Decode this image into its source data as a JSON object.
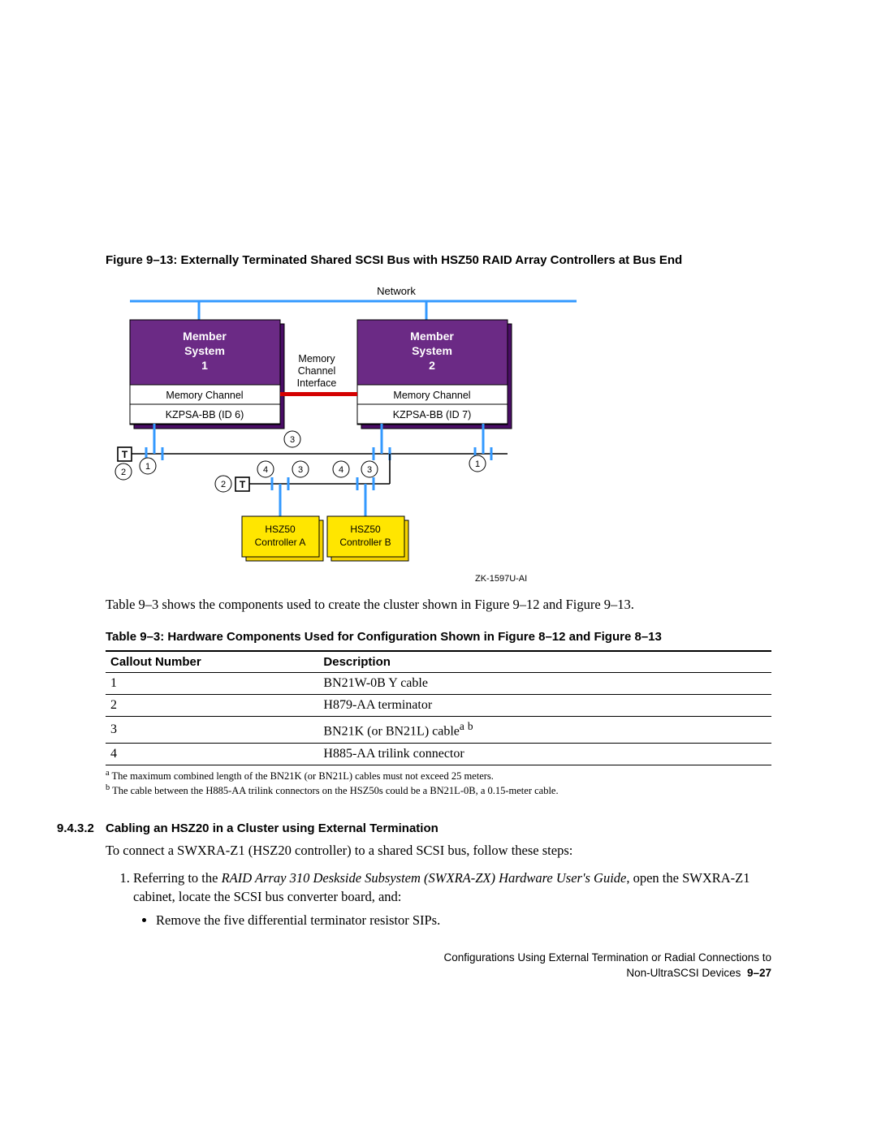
{
  "figure": {
    "caption": "Figure 9–13: Externally Terminated Shared SCSI Bus with HSZ50 RAID Array Controllers at Bus End",
    "labels": {
      "network": "Network",
      "member1_l1": "Member",
      "member1_l2": "System",
      "member1_l3": "1",
      "member2_l1": "Member",
      "member2_l2": "System",
      "member2_l3": "2",
      "mci_l1": "Memory",
      "mci_l2": "Channel",
      "mci_l3": "Interface",
      "mc1": "Memory Channel",
      "mc2": "Memory Channel",
      "kzpsa1": "KZPSA-BB (ID 6)",
      "kzpsa2": "KZPSA-BB (ID 7)",
      "hsz_a_l1": "HSZ50",
      "hsz_a_l2": "Controller A",
      "hsz_b_l1": "HSZ50",
      "hsz_b_l2": "Controller B",
      "T": "T",
      "c1": "1",
      "c2": "2",
      "c3": "3",
      "c4": "4"
    },
    "id": "ZK-1597U-AI"
  },
  "intro_text": "Table 9–3 shows the components used to create the cluster shown in Figure 9–12 and Figure 9–13.",
  "table": {
    "caption": "Table 9–3: Hardware Components Used for Configuration Shown in Figure 8–12 and Figure 8–13",
    "headers": {
      "c1": "Callout Number",
      "c2": "Description"
    },
    "rows": {
      "r1c1": "1",
      "r1c2": "BN21W-0B Y cable",
      "r2c1": "2",
      "r2c2": "H879-AA terminator",
      "r3c1": "3",
      "r3c2_pre": "BN21K (or BN21L) cable",
      "r4c1": "4",
      "r4c2": "H885-AA trilink connector"
    },
    "footnotes": {
      "a": "The maximum combined length of the BN21K (or BN21L) cables must not exceed 25 meters.",
      "b": "The cable between the H885-AA trilink connectors on the HSZ50s could be a BN21L-0B, a 0.15-meter cable."
    }
  },
  "section": {
    "number": "9.4.3.2",
    "title": "Cabling an HSZ20 in a Cluster using External Termination",
    "p1": "To connect a SWXRA-Z1 (HSZ20 controller) to a shared SCSI bus, follow these steps:",
    "step1_lead": "Referring to the ",
    "step1_em": "RAID Array 310 Deskside Subsystem (SWXRA-ZX) Hardware User's Guide",
    "step1_tail": ", open the SWXRA-Z1 cabinet, locate the SCSI bus converter board, and:",
    "bullet1": "Remove the five differential terminator resistor SIPs."
  },
  "footer": {
    "l1": "Configurations Using External Termination or Radial Connections to",
    "l2_pre": "Non-UltraSCSI Devices",
    "l2_page": "9–27"
  }
}
